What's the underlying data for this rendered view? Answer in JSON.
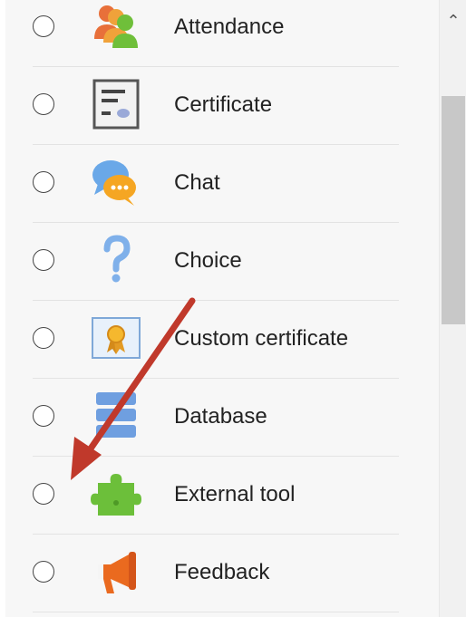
{
  "activity_list": {
    "items": [
      {
        "label": "Attendance",
        "icon": "attendance-icon"
      },
      {
        "label": "Certificate",
        "icon": "certificate-icon"
      },
      {
        "label": "Chat",
        "icon": "chat-icon"
      },
      {
        "label": "Choice",
        "icon": "question-icon"
      },
      {
        "label": "Custom certificate",
        "icon": "award-ribbon-icon"
      },
      {
        "label": "Database",
        "icon": "database-icon"
      },
      {
        "label": "External tool",
        "icon": "puzzle-piece-icon"
      },
      {
        "label": "Feedback",
        "icon": "megaphone-icon"
      }
    ]
  },
  "scrollbar": {
    "up_icon": "chevron-up-icon"
  },
  "annotation": {
    "color": "#c0392b",
    "icon": "red-arrow-annotation"
  }
}
